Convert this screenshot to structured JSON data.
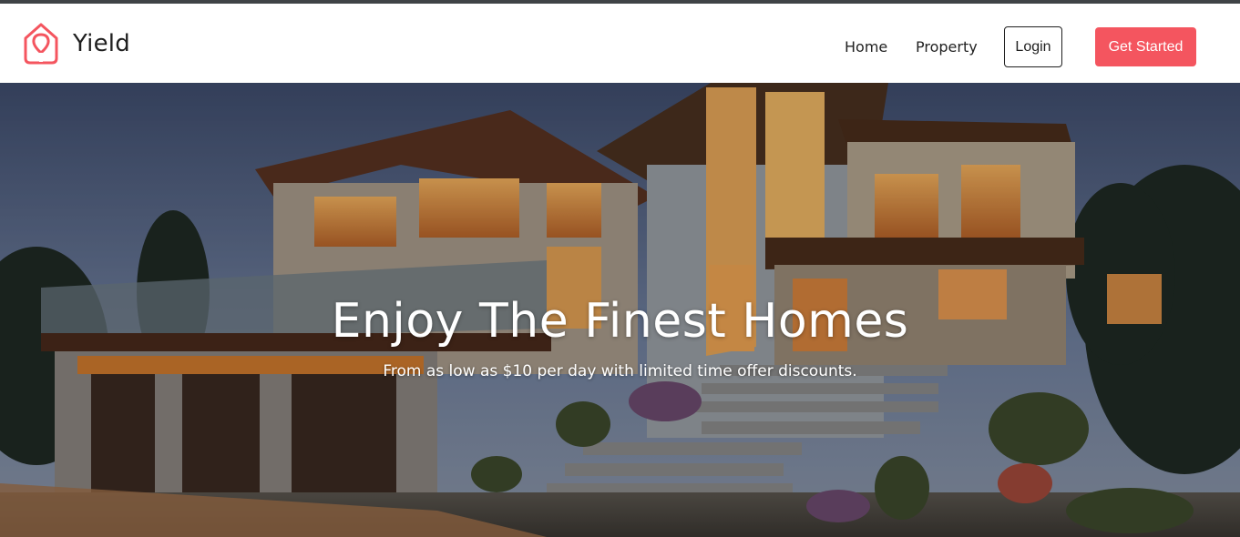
{
  "navbar": {
    "brand": "Yield",
    "logo_icon": "home-logo-icon",
    "links": [
      "Home",
      "Property"
    ],
    "login_label": "Login",
    "cta_label": "Get Started"
  },
  "hero": {
    "title": "Enjoy The Finest Homes",
    "subtitle": "From as low as $10 per day with limited time offer discounts."
  },
  "colors": {
    "accent": "#f4555f",
    "topbar": "#3f4346",
    "text": "#1f1f1f"
  }
}
